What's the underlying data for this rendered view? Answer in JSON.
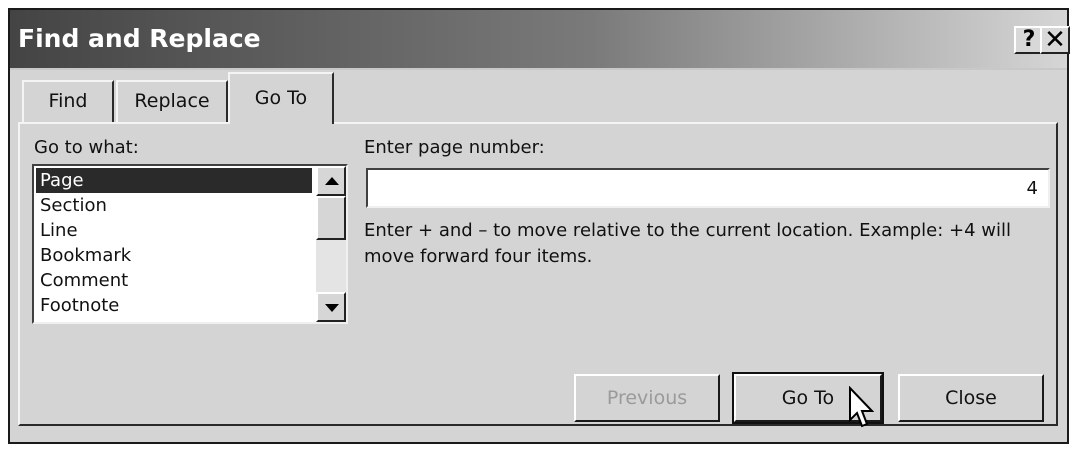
{
  "window": {
    "title": "Find and Replace",
    "help_label": "?",
    "close_label": "✕"
  },
  "tabs": [
    {
      "label": "Find",
      "active": false
    },
    {
      "label": "Replace",
      "active": false
    },
    {
      "label": "Go To",
      "active": true
    }
  ],
  "goto_what": {
    "label": "Go to what:",
    "items": [
      "Page",
      "Section",
      "Line",
      "Bookmark",
      "Comment",
      "Footnote"
    ],
    "selected": "Page"
  },
  "page_number": {
    "label": "Enter page number:",
    "value": "4"
  },
  "hint": "Enter + and – to move relative to the current location. Example: +4 will move forward four items.",
  "buttons": {
    "previous": "Previous",
    "goto": "Go To",
    "close": "Close"
  },
  "icons": [
    "help-icon",
    "close-icon",
    "scroll-up-icon",
    "scroll-down-icon",
    "mouse-pointer-icon"
  ]
}
